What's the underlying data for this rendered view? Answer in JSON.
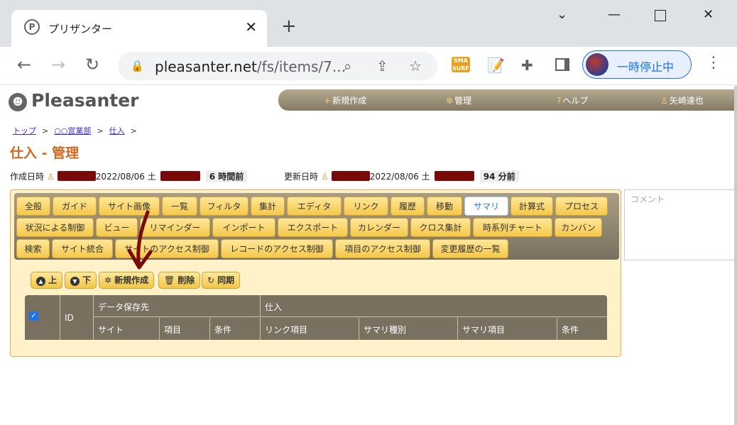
{
  "browser": {
    "tab_title": "プリザンター",
    "tab_favicon_letter": "P",
    "url_host": "pleasanter.net",
    "url_path": "/fs/items/7...",
    "profile_label": "一時停止中"
  },
  "app": {
    "logo": "Pleasanter",
    "nav": [
      "新規作成",
      "管理",
      "ヘルプ",
      "矢崎達也"
    ]
  },
  "breadcrumb": [
    "トップ",
    "○○営業部",
    "仕入"
  ],
  "page_title": "仕入 - 管理",
  "meta": {
    "created_label": "作成日時",
    "created_date": "2022/08/06 土",
    "created_elapsed": "6 時間前",
    "updated_label": "更新日時",
    "updated_date": "2022/08/06 土",
    "updated_elapsed": "94 分前"
  },
  "editor_tabs": {
    "row1": [
      "全般",
      "ガイド",
      "サイト画像",
      "一覧",
      "フィルタ",
      "集計",
      "エディタ",
      "リンク",
      "履歴",
      "移動",
      "サマリ",
      "計算式",
      "プロセス"
    ],
    "row2": [
      "状況による制御",
      "ビュー",
      "リマインダー",
      "インポート",
      "エクスポート",
      "カレンダー",
      "クロス集計",
      "時系列チャート",
      "カンバン"
    ],
    "row3": [
      "検索",
      "サイト統合",
      "サイトのアクセス制御",
      "レコードのアクセス制御",
      "項目のアクセス制御",
      "変更履歴の一覧"
    ],
    "active": "サマリ"
  },
  "buttons": [
    "上",
    "下",
    "新規作成",
    "削除",
    "同期"
  ],
  "grid": {
    "id": "ID",
    "group1": "データ保存先",
    "group2": "仕入",
    "columns": [
      "サイト",
      "項目",
      "条件",
      "リンク項目",
      "サマリ種別",
      "サマリ項目",
      "条件"
    ]
  },
  "comment_placeholder": "コメント"
}
